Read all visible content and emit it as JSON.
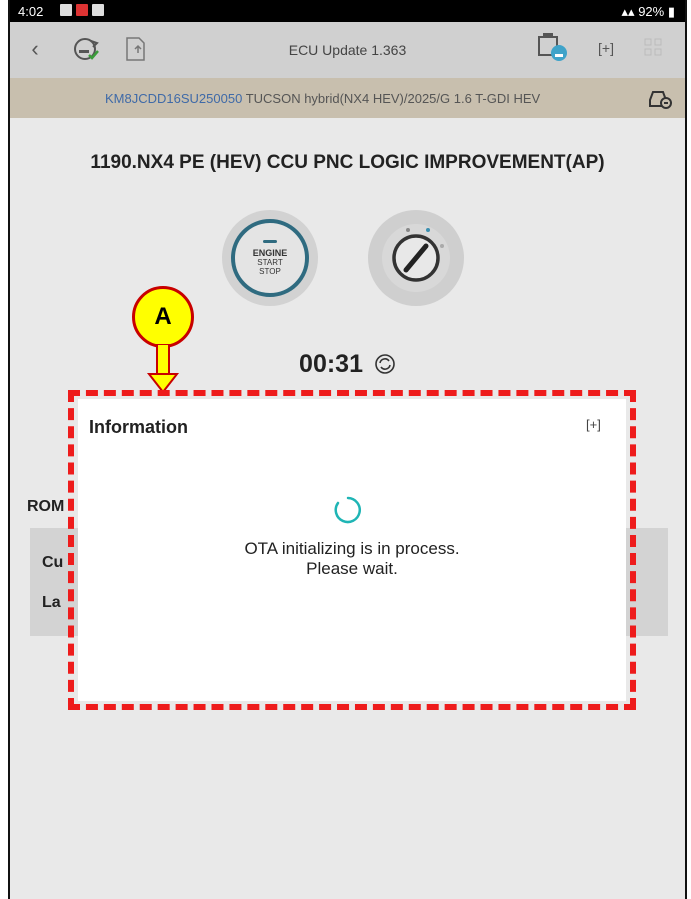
{
  "status_bar": {
    "time": "4:02",
    "battery": "92%"
  },
  "app_bar": {
    "title": "ECU Update 1.363"
  },
  "vehicle_bar": {
    "vin": "KM8JCDD16SU250050",
    "description": "TUCSON hybrid(NX4 HEV)/2025/G 1.6 T-GDI HEV"
  },
  "main": {
    "title": "1190.NX4 PE (HEV) CCU PNC LOGIC IMPROVEMENT(AP)",
    "engine_button": {
      "line1": "ENGINE",
      "line2": "START",
      "line3": "STOP"
    },
    "timer": "00:31",
    "rom": {
      "label": "ROM",
      "current_label": "Cu",
      "latest_label": "La"
    }
  },
  "annotation": {
    "label": "A"
  },
  "dialog": {
    "title": "Information",
    "message_line1": "OTA initializing is in process.",
    "message_line2": "Please wait."
  },
  "colors": {
    "dialog_outline": "#ee1c1c",
    "callout_fill": "#ffff00",
    "spinner": "#1fb5b5",
    "vin_text": "#3f6aa8"
  }
}
